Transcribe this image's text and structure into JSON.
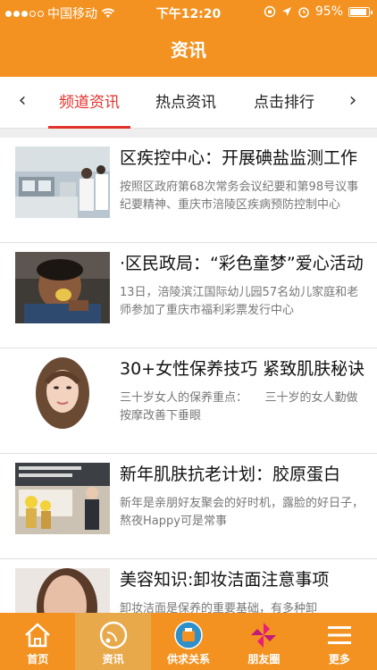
{
  "status_bar": {
    "carrier": "中国移动",
    "time": "下午12:20",
    "battery": "95%",
    "battery_level": 0.95
  },
  "header": {
    "title": "资讯"
  },
  "tabs": {
    "items": [
      "频道资讯",
      "热点资讯",
      "点击排行"
    ],
    "active": 0,
    "left_arrow": "‹",
    "right_arrow": "›"
  },
  "news": [
    {
      "title": "区疾控中心：开展碘盐监测工作",
      "summary": "按照区政府第68次常务会议纪要和第98号议事纪要精神、重庆市涪陵区疾病预防控制中心",
      "image": "lab-photo"
    },
    {
      "title": "·区民政局：“彩色童梦”爱心活动",
      "summary": "13日，涪陵滨江国际幼儿园57名幼儿家庭和老师参加了重庆市福利彩票发行中心",
      "image": "child-eating-photo"
    },
    {
      "title": "30+女性保养技巧 紧致肌肤秘诀",
      "summary": "三十岁女人的保养重点：　　三十岁的女人勤做按摩改善下垂眼",
      "image": "woman-portrait-photo"
    },
    {
      "title": "新年肌肤抗老计划：胶原蛋白",
      "summary": "新年是亲朋好友聚会的好时机，露脸的好日子，熬夜Happy可是常事",
      "image": "presentation-photo"
    },
    {
      "title": "美容知识:卸妆洁面注意事项",
      "summary": "卸妆洁面是保养的重要基础，有多种卸",
      "image": "woman-face-photo"
    }
  ],
  "tabbar": [
    {
      "label": "首页",
      "icon": "home-icon"
    },
    {
      "label": "资讯",
      "icon": "news-icon"
    },
    {
      "label": "供求关系",
      "icon": "supply-icon"
    },
    {
      "label": "朋友圈",
      "icon": "friends-icon"
    },
    {
      "label": "更多",
      "icon": "more-icon"
    }
  ],
  "colors": {
    "brand": "#f39220",
    "accent": "#e3322b"
  }
}
